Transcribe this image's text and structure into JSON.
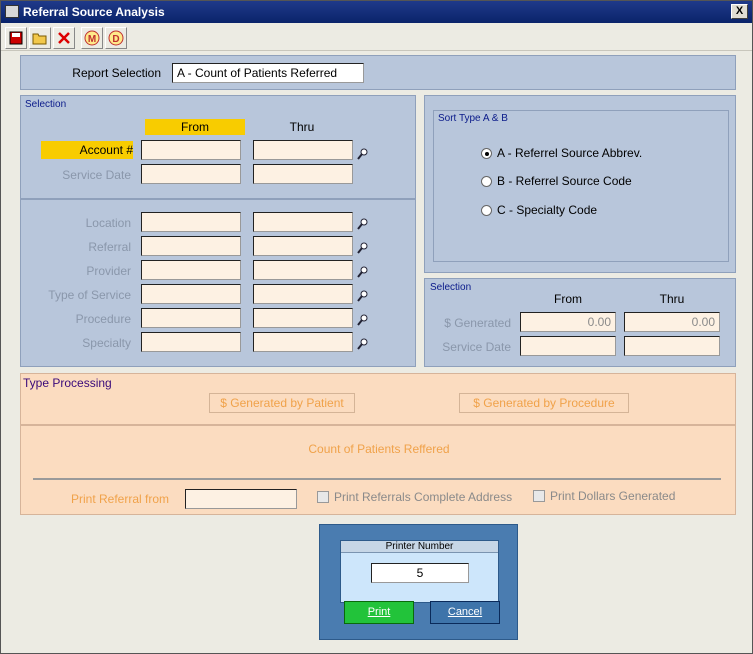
{
  "window": {
    "title": "Referral Source Analysis",
    "close": "X"
  },
  "toolbar": {
    "icons": [
      "save-icon",
      "open-folder-icon",
      "cancel-x-icon",
      "m-icon",
      "d-icon"
    ],
    "m_label": "M",
    "d_label": "D"
  },
  "report_selection": {
    "label": "Report Selection",
    "value": "A - Count of Patients Referred"
  },
  "selection": {
    "title": "Selection",
    "from": "From",
    "thru": "Thru",
    "fields": [
      {
        "label": "Account #"
      },
      {
        "label": "Service Date"
      },
      {
        "label": "Location"
      },
      {
        "label": "Referral"
      },
      {
        "label": "Provider"
      },
      {
        "label": "Type of Service"
      },
      {
        "label": "Procedure"
      },
      {
        "label": "Specialty"
      }
    ]
  },
  "sort_type": {
    "title": "Sort Type A & B",
    "options": [
      {
        "label": "A - Referrel Source Abbrev.",
        "selected": true
      },
      {
        "label": "B - Referrel Source Code",
        "selected": false
      },
      {
        "label": "C - Specialty Code",
        "selected": false
      }
    ]
  },
  "selection2": {
    "title": "Selection",
    "from": "From",
    "thru": "Thru",
    "generated_label": "$ Generated",
    "generated_from": "0.00",
    "generated_thru": "0.00",
    "service_date_label": "Service Date"
  },
  "type_processing": {
    "title": "Type Processing",
    "by_patient": "$ Generated by Patient",
    "by_procedure": "$ Generated by Procedure",
    "mode_label": "Count of Patients Reffered",
    "print_from_label": "Print Referral from",
    "print_address": "Print Referrals Complete Address",
    "print_dollars": "Print Dollars Generated"
  },
  "printer": {
    "title": "Printer Number",
    "value": "5",
    "print": "Print",
    "cancel": "Cancel"
  }
}
